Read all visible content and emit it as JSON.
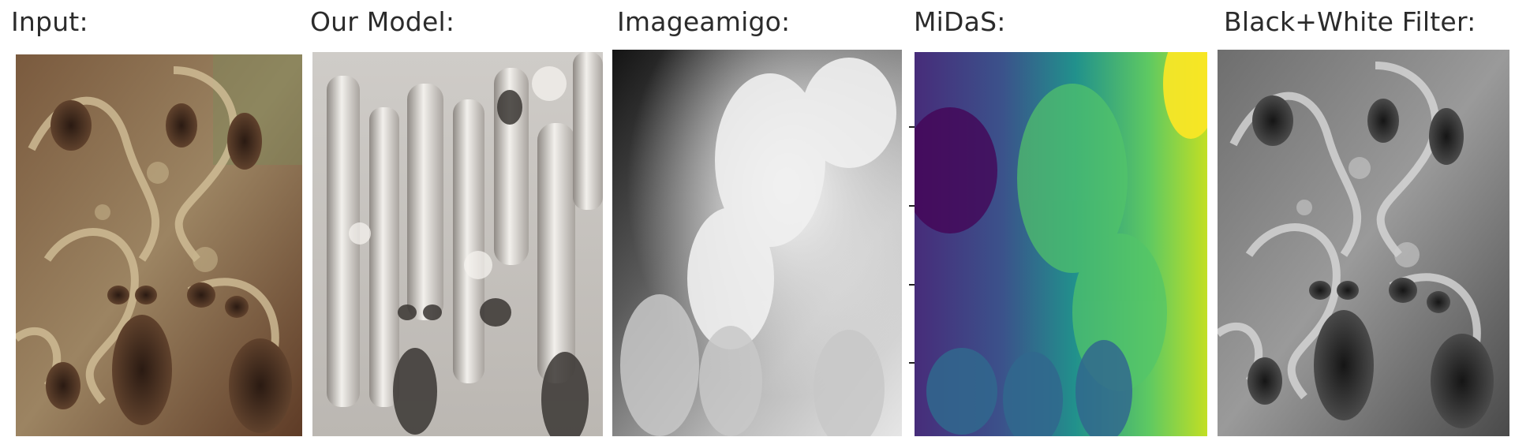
{
  "panels": [
    {
      "id": "input",
      "label": "Input:",
      "kind": "ornate-color",
      "colors": [
        "#6f5a3e",
        "#8a7150",
        "#b49a72",
        "#4a2e1e",
        "#7d8a5a"
      ]
    },
    {
      "id": "our-model",
      "label": "Our Model:",
      "kind": "relief-gray",
      "colors": [
        "#d9d6d2",
        "#bdb9b4",
        "#8f8a85",
        "#f2f0ec",
        "#2f2d2b"
      ]
    },
    {
      "id": "imageamigo",
      "label": "Imageamigo:",
      "kind": "depth-gray",
      "colors": [
        "#1c1c1c",
        "#6b6b6b",
        "#c9c9c9",
        "#f4f4f4"
      ]
    },
    {
      "id": "midas",
      "label": "MiDaS:",
      "kind": "depth-viridis",
      "colors": [
        "#440154",
        "#3b528b",
        "#21918c",
        "#5ec962",
        "#fde725"
      ]
    },
    {
      "id": "bw-filter",
      "label": "Black+White Filter:",
      "kind": "ornate-gray",
      "colors": [
        "#2a2a2a",
        "#5a5a5a",
        "#8a8a8a",
        "#c4c4c4",
        "#e6e6e6"
      ]
    }
  ]
}
